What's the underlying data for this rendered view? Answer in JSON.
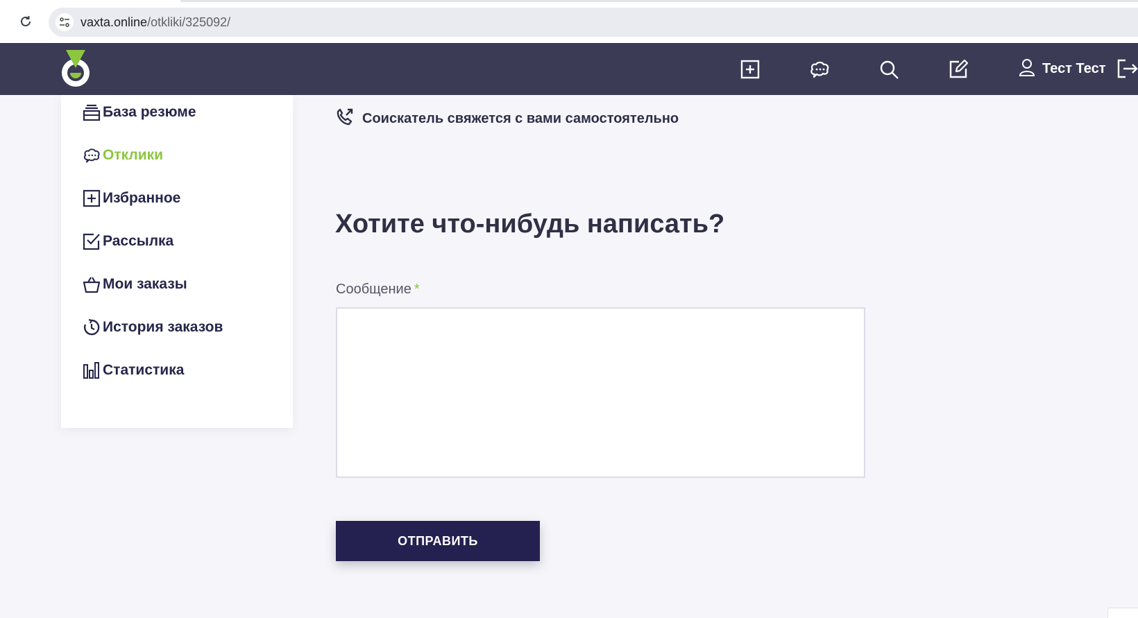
{
  "browser": {
    "url_host": "vaxta.online",
    "url_path": "/otkliki/325092/"
  },
  "header": {
    "user_name": "Тест Тест",
    "icons": [
      "add-square-icon",
      "chat-icon",
      "search-icon",
      "edit-icon",
      "user-icon",
      "logout-icon"
    ]
  },
  "sidebar": {
    "items": [
      {
        "label": "База резюме",
        "icon": "resume-stack-icon",
        "active": false
      },
      {
        "label": "Отклики",
        "icon": "chat-icon",
        "active": true
      },
      {
        "label": "Избранное",
        "icon": "add-square-icon",
        "active": false
      },
      {
        "label": "Рассылка",
        "icon": "checkbox-icon",
        "active": false
      },
      {
        "label": "Мои заказы",
        "icon": "basket-icon",
        "active": false
      },
      {
        "label": "История заказов",
        "icon": "history-icon",
        "active": false
      },
      {
        "label": "Статистика",
        "icon": "bar-chart-icon",
        "active": false
      }
    ]
  },
  "main": {
    "contact_note": "Соискатель свяжется с вами самостоятельно",
    "heading": "Хотите что-нибудь написать?",
    "message_label": "Сообщение",
    "required_mark": "*",
    "message_value": "",
    "submit_label": "ОТПРАВИТЬ"
  },
  "colors": {
    "header_bg": "#3b3b56",
    "accent_green": "#8dc63f",
    "button_bg": "#24204f",
    "page_bg": "#f6f6fa"
  }
}
